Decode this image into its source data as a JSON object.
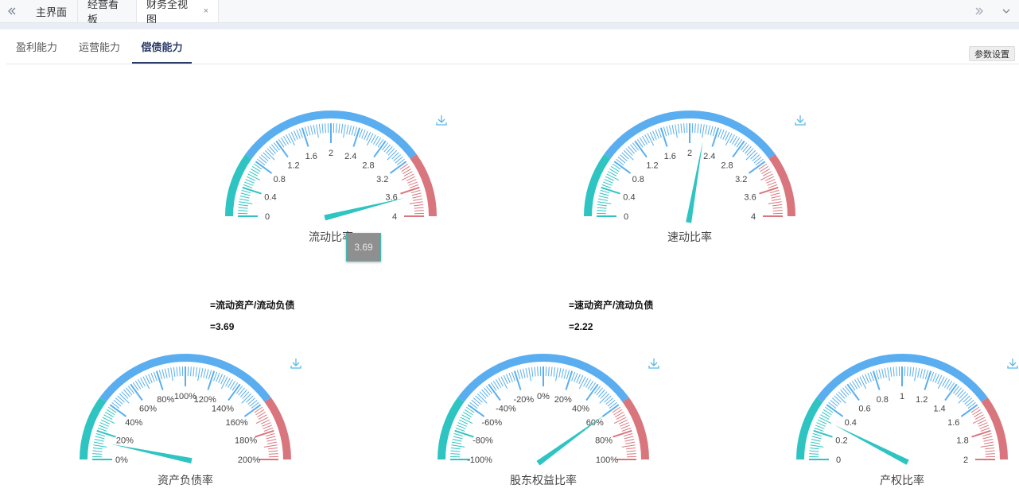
{
  "topbar": {
    "tabs": [
      {
        "label": "主界面"
      },
      {
        "label": "经营看板"
      },
      {
        "label": "财务全视图",
        "close": "×"
      }
    ]
  },
  "subtabs": [
    {
      "label": "盈利能力"
    },
    {
      "label": "运营能力"
    },
    {
      "label": "偿债能力"
    }
  ],
  "param_button": "参数设置",
  "colors": {
    "teal": "#2ec4c2",
    "blue": "#5aaef0",
    "red": "#d9757d",
    "active_tab": "#2a3a66"
  },
  "gauges": [
    {
      "title": "流动比率",
      "min": 0,
      "max": 4,
      "value": 3.69,
      "tick_labels": [
        "0",
        "0.4",
        "0.8",
        "1.2",
        "1.6",
        "2",
        "2.4",
        "2.8",
        "3.2",
        "3.6",
        "4"
      ],
      "formula": "=流动资产/流动负债",
      "result": "=3.69"
    },
    {
      "title": "速动比率",
      "min": 0,
      "max": 4,
      "value": 2.22,
      "tick_labels": [
        "0",
        "0.4",
        "0.8",
        "1.2",
        "1.6",
        "2",
        "2.4",
        "2.8",
        "3.2",
        "3.6",
        "4"
      ],
      "formula": "=速动资产/流动负债",
      "result": "=2.22"
    },
    {
      "title": "资产负债率",
      "min": 0,
      "max": 200,
      "value": 13,
      "tick_labels": [
        "0%",
        "20%",
        "40%",
        "60%",
        "80%",
        "100%",
        "120%",
        "140%",
        "160%",
        "180%",
        "200%"
      ]
    },
    {
      "title": "股东权益比率",
      "min": -100,
      "max": 100,
      "value": 60,
      "tick_labels": [
        "-100%",
        "-80%",
        "-60%",
        "-40%",
        "-20%",
        "0%",
        "20%",
        "40%",
        "60%",
        "80%",
        "100%"
      ]
    },
    {
      "title": "产权比率",
      "min": 0,
      "max": 2,
      "value": 0.3,
      "tick_labels": [
        "0",
        "0.2",
        "0.4",
        "0.6",
        "0.8",
        "1",
        "1.2",
        "1.4",
        "1.6",
        "1.8",
        "2"
      ]
    }
  ],
  "tooltip": {
    "value": "3.69"
  }
}
